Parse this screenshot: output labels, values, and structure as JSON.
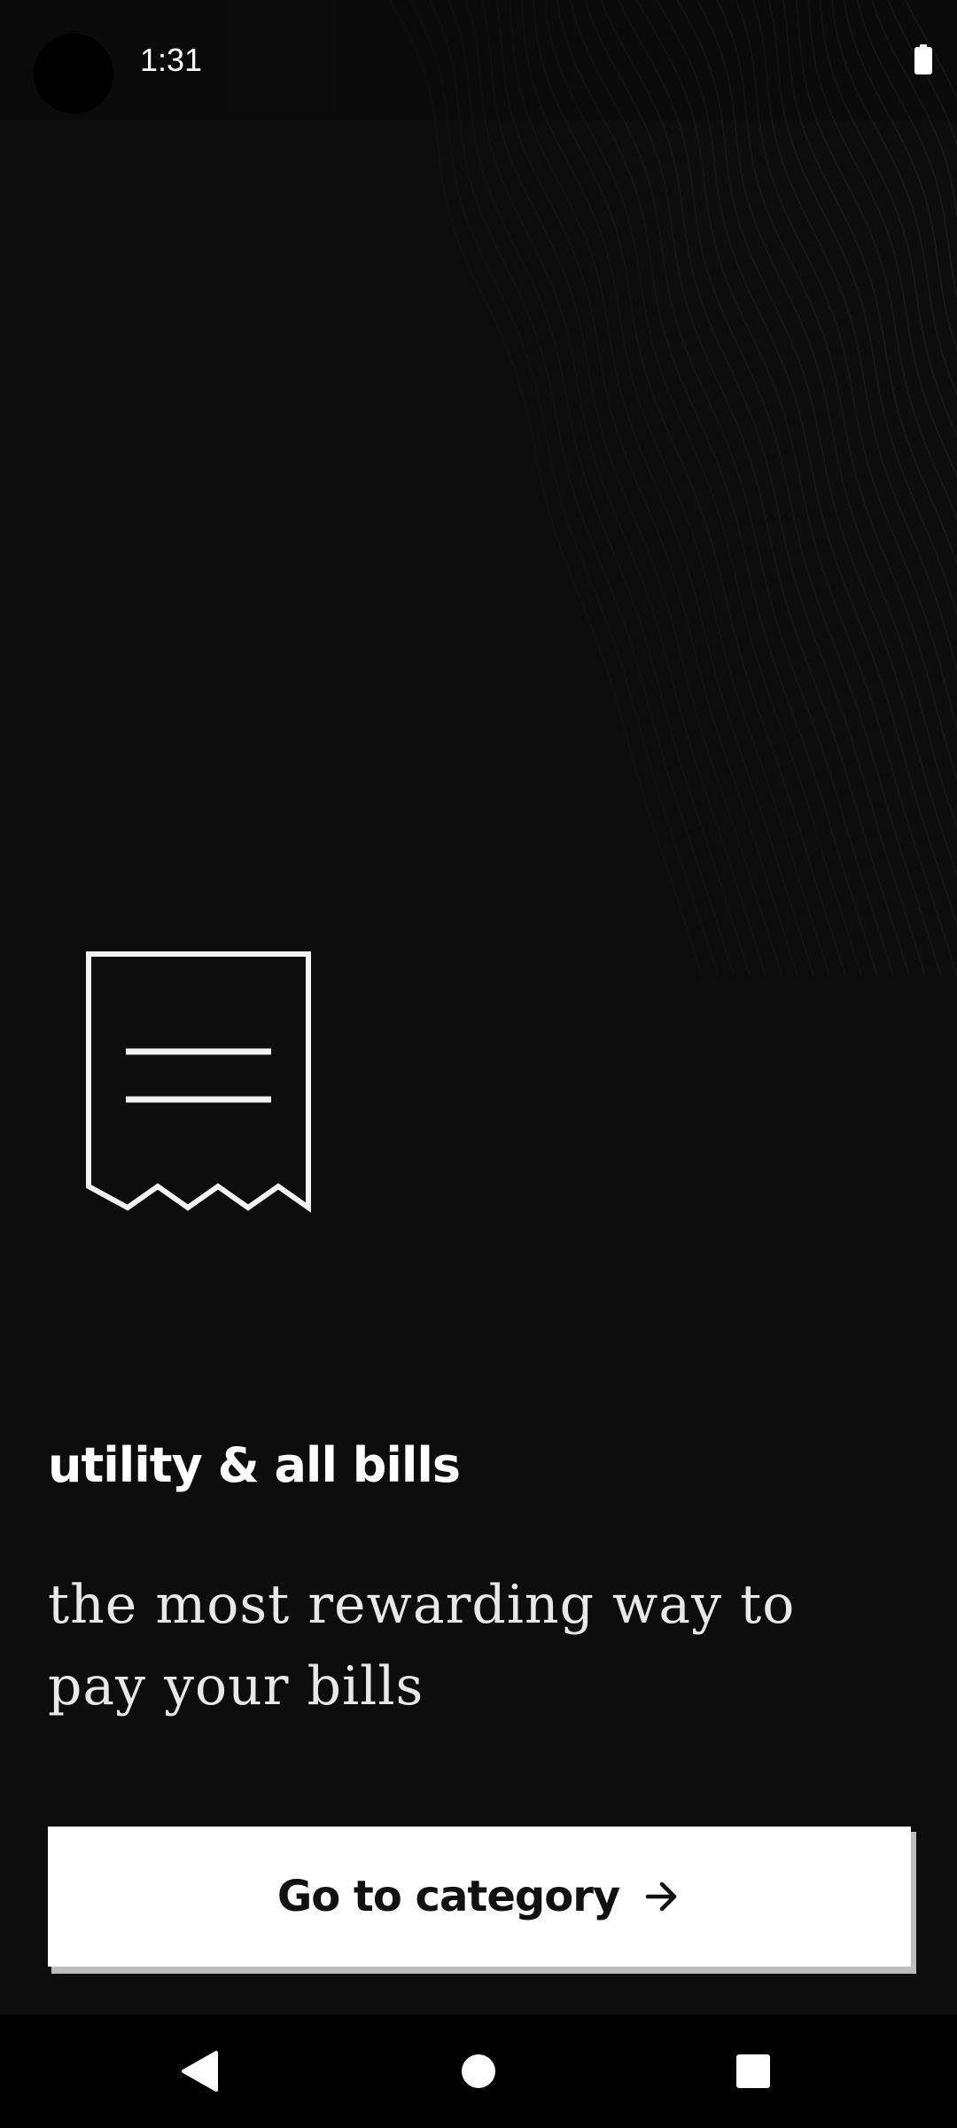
{
  "status_bar": {
    "time": "1:31",
    "battery_icon": "battery-full-icon"
  },
  "hero": {
    "icon": "receipt-icon"
  },
  "category": {
    "title": "utility & all bills",
    "tagline": "the most rewarding way to pay your bills"
  },
  "cta": {
    "label": "Go to category",
    "icon": "arrow-right-icon"
  },
  "nav_bar": {
    "back_icon": "back-triangle-icon",
    "home_icon": "home-circle-icon",
    "recents_icon": "recents-square-icon"
  },
  "colors": {
    "background": "#0d0d0d",
    "text_primary": "#ffffff",
    "button_bg": "#ffffff",
    "button_text": "#111111",
    "button_shadow": "#bdbdbd"
  }
}
